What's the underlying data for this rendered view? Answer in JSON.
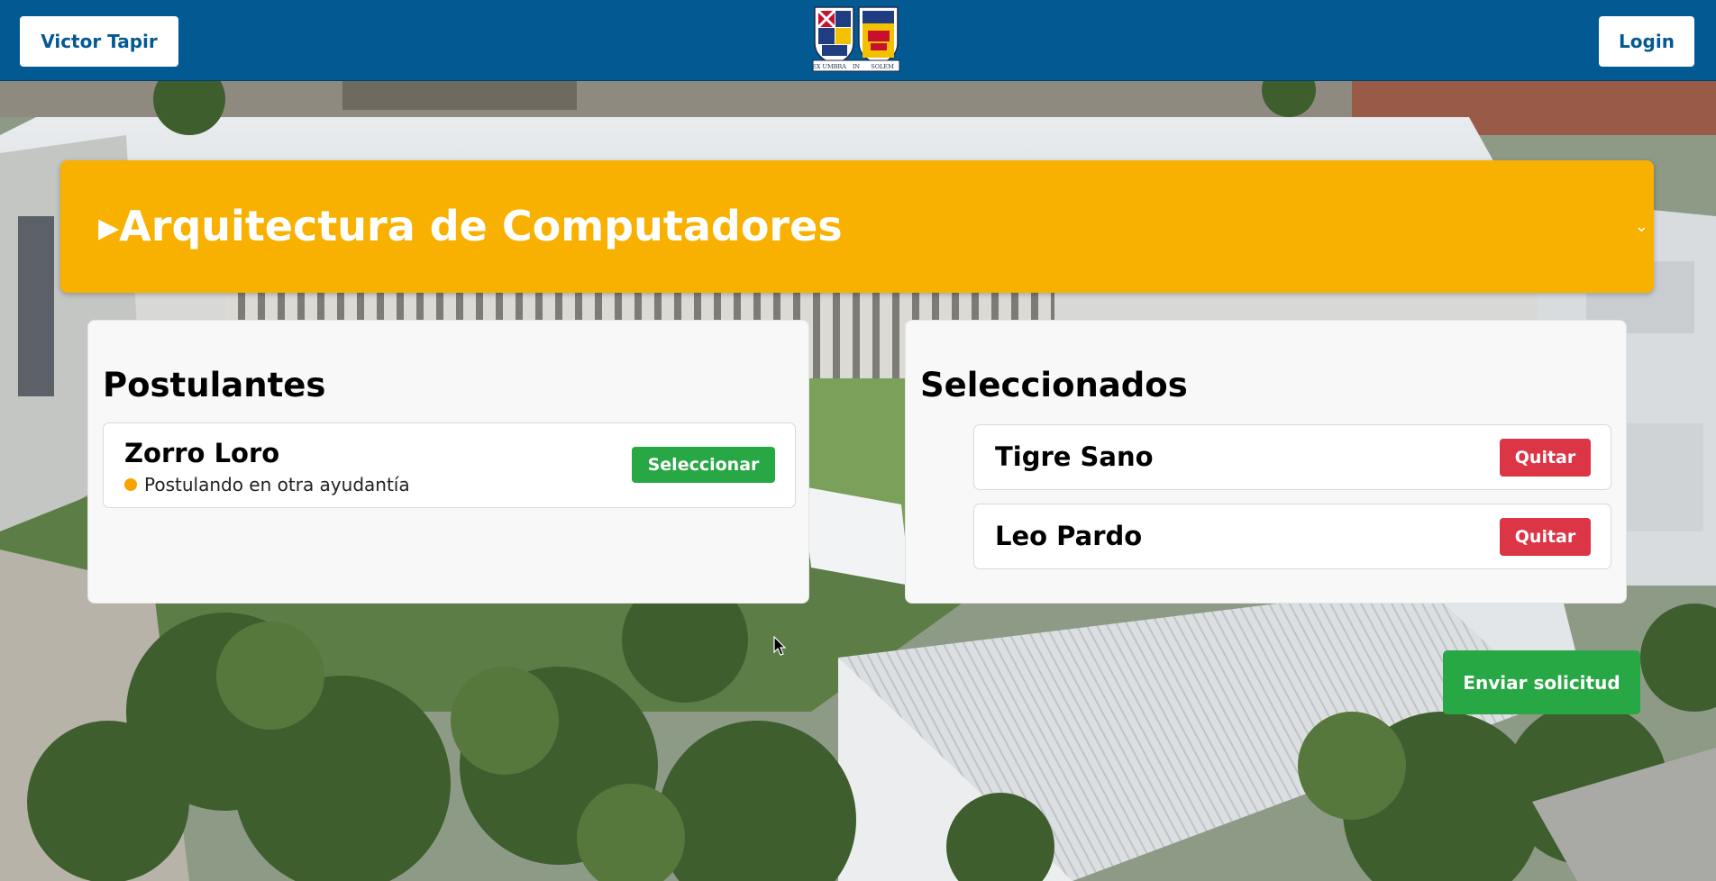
{
  "header": {
    "user_label": "Victor Tapir",
    "login_label": "Login",
    "logo_icon": "university-crest",
    "logo_motto_left": "EX UMBRA",
    "logo_motto_mid": "IN",
    "logo_motto_right": "SOLEM"
  },
  "course": {
    "title": "▸Arquitectura de Computadores",
    "chevron_icon": "chevron-down-icon"
  },
  "postulantes": {
    "title": "Postulantes",
    "candidates": [
      {
        "name": "Zorro Loro",
        "status": "Postulando en otra ayudantía",
        "status_color": "#f8a400",
        "action_label": "Seleccionar"
      }
    ]
  },
  "seleccionados": {
    "title": "Seleccionados",
    "items": [
      {
        "name": "Tigre Sano",
        "action_label": "Quitar"
      },
      {
        "name": "Leo Pardo",
        "action_label": "Quitar"
      }
    ]
  },
  "send_label": "Enviar solicitud",
  "colors": {
    "header": "#035a93",
    "course_banner": "#f8b100",
    "success": "#28a745",
    "danger": "#dc3545"
  }
}
